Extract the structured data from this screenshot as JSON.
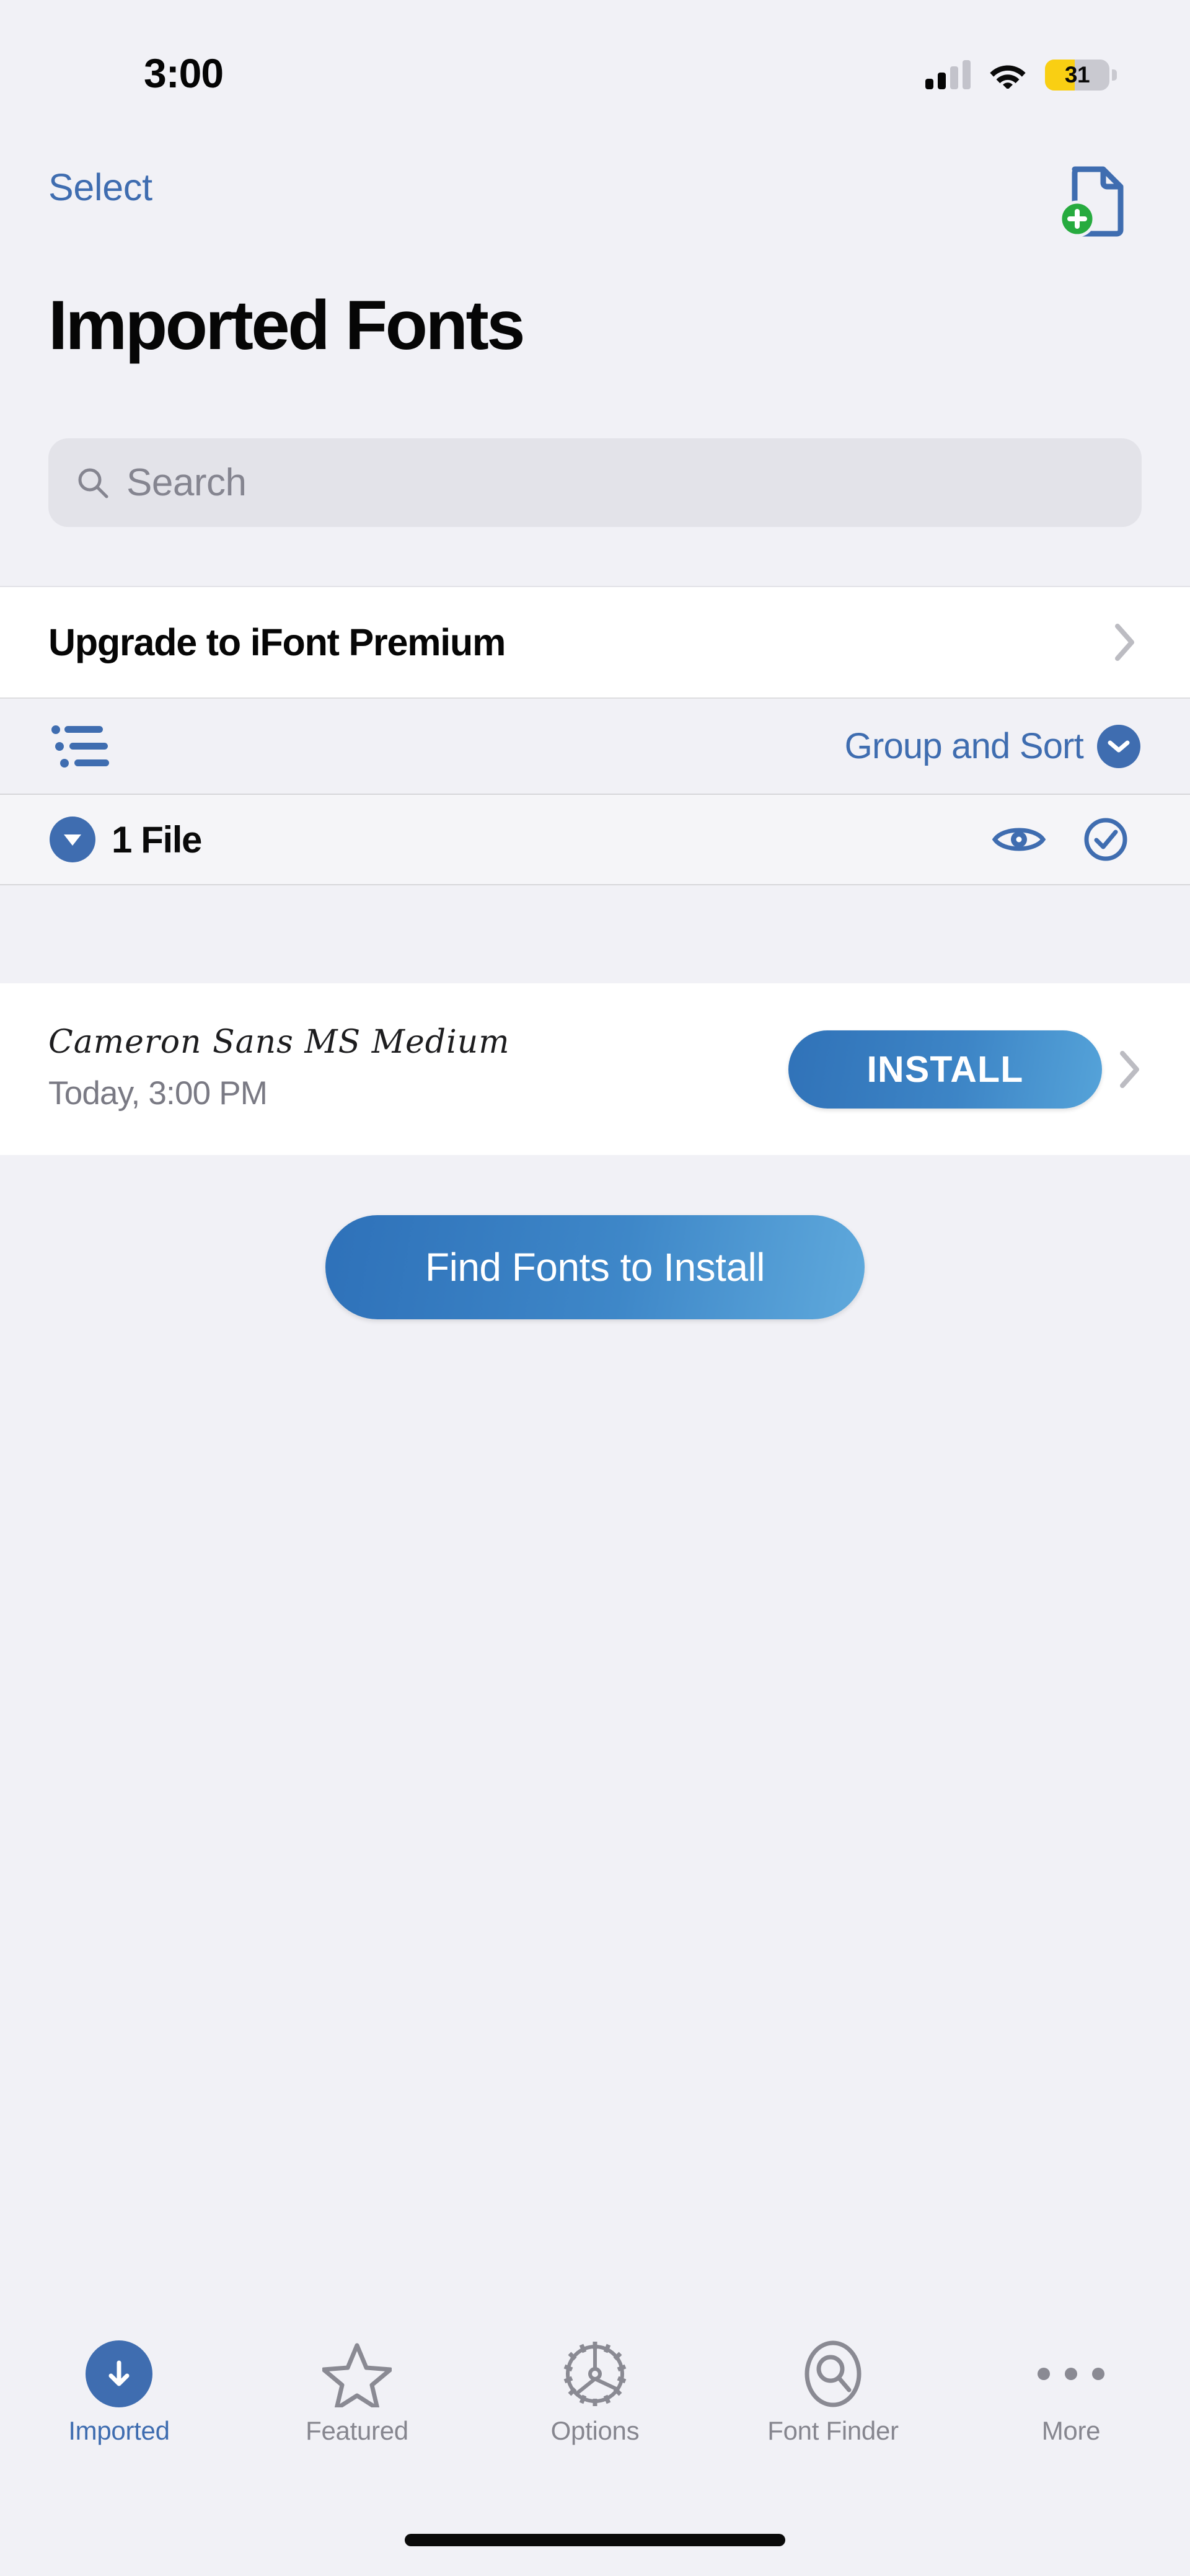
{
  "status_bar": {
    "time": "3:00",
    "battery_percent": "31",
    "battery_level": 31,
    "cellular_bars_filled": 2,
    "cellular_bars_total": 4,
    "wifi_icon": "wifi-icon",
    "signal_icon": "cellular-signal-icon",
    "battery_icon": "battery-icon",
    "battery_low_power_color": "#f9cf13"
  },
  "nav_bar": {
    "select_label": "Select",
    "add_document_icon": "add-document-icon",
    "add_badge_color": "#27ab3f",
    "doc_outline_color": "#3f6db0"
  },
  "page": {
    "title": "Imported Fonts",
    "accent_color": "#3f6db0",
    "background_color": "#f1f1f6"
  },
  "search": {
    "placeholder": "Search",
    "value": "",
    "icon": "search-icon",
    "field_color": "#e3e3e9"
  },
  "premium": {
    "label": "Upgrade to iFont Premium",
    "chevron_icon": "chevron-right-icon"
  },
  "toolbar": {
    "list_icon": "list-bullet-icon",
    "group_sort_label": "Group and Sort",
    "chevron_icon": "chevron-down-circle-icon"
  },
  "group_header": {
    "disclosure_icon": "triangle-down-icon",
    "count_label": "1 File",
    "preview_icon": "eye-icon",
    "select_all_icon": "checkmark-circle-icon"
  },
  "font_list": {
    "rows": [
      {
        "name": "Cameron Sans MS Medium",
        "date": "Today, 3:00 PM",
        "action_label": "INSTALL",
        "chevron_icon": "chevron-right-icon"
      }
    ]
  },
  "find_button": {
    "label": "Find Fonts to Install"
  },
  "tab_bar": {
    "active_index": 0,
    "items": [
      {
        "label": "Imported",
        "icon": "download-circle-icon"
      },
      {
        "label": "Featured",
        "icon": "star-icon"
      },
      {
        "label": "Options",
        "icon": "gear-icon"
      },
      {
        "label": "Font Finder",
        "icon": "search-circle-icon"
      },
      {
        "label": "More",
        "icon": "ellipsis-icon"
      }
    ]
  },
  "home_indicator": {
    "name": "home-indicator"
  }
}
